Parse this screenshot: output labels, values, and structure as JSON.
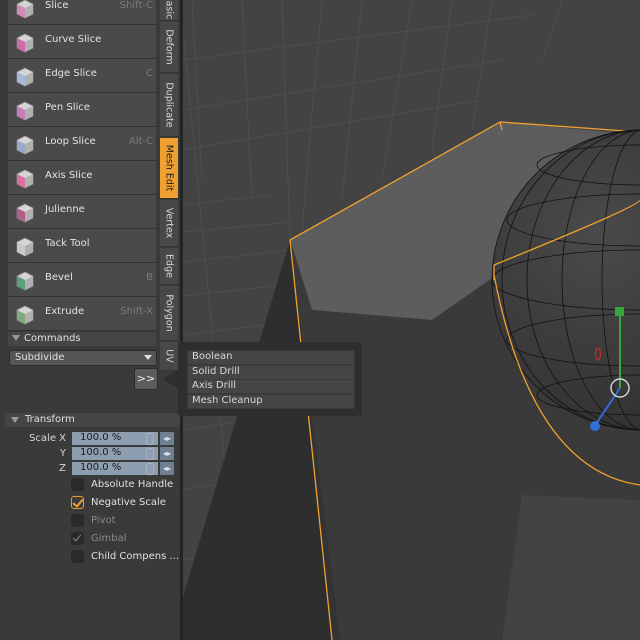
{
  "toolbar": {
    "tools": [
      {
        "label": "Slice",
        "shortcut": "Shift-C",
        "icon": "slice-icon"
      },
      {
        "label": "Curve Slice",
        "shortcut": "",
        "icon": "curve-slice-icon"
      },
      {
        "label": "Edge Slice",
        "shortcut": "C",
        "icon": "edge-slice-icon"
      },
      {
        "label": "Pen Slice",
        "shortcut": "",
        "icon": "pen-slice-icon"
      },
      {
        "label": "Loop Slice",
        "shortcut": "Alt-C",
        "icon": "loop-slice-icon"
      },
      {
        "label": "Axis Slice",
        "shortcut": "",
        "icon": "axis-slice-icon"
      },
      {
        "label": "Julienne",
        "shortcut": "",
        "icon": "julienne-icon"
      },
      {
        "label": "Tack Tool",
        "shortcut": "",
        "icon": "tack-tool-icon"
      },
      {
        "label": "Bevel",
        "shortcut": "B",
        "icon": "bevel-icon"
      },
      {
        "label": "Extrude",
        "shortcut": "Shift-X",
        "icon": "extrude-icon"
      }
    ]
  },
  "vertical_tabs": [
    "asic",
    "Deform",
    "Duplicate",
    "Mesh Edit",
    "Vertex",
    "Edge",
    "Polygon",
    "UV"
  ],
  "active_tab": "Mesh Edit",
  "commands": {
    "header": "Commands",
    "selected": "Subdivide",
    "more_label": ">>",
    "popup_items": [
      "Boolean",
      "Solid Drill",
      "Axis Drill",
      "Mesh Cleanup"
    ]
  },
  "transform": {
    "header": "Transform",
    "scale": [
      {
        "label": "Scale X",
        "value": "100.0 %"
      },
      {
        "label": "Y",
        "value": "100.0 %"
      },
      {
        "label": "Z",
        "value": "100.0 %"
      }
    ],
    "checkboxes": [
      {
        "label": "Absolute Handle",
        "checked": false,
        "enabled": true
      },
      {
        "label": "Negative Scale",
        "checked": true,
        "enabled": true
      },
      {
        "label": "Pivot",
        "checked": false,
        "enabled": false
      },
      {
        "label": "Gimbal",
        "checked": true,
        "enabled": false
      },
      {
        "label": "Child Compens ...",
        "checked": false,
        "enabled": true
      }
    ]
  },
  "colors": {
    "accent": "#f0a030",
    "selection_edge": "#f0a030",
    "axis_y": "#3aa53a",
    "axis_z": "#2f6fd8",
    "axis_x": "#cc2a2a"
  }
}
